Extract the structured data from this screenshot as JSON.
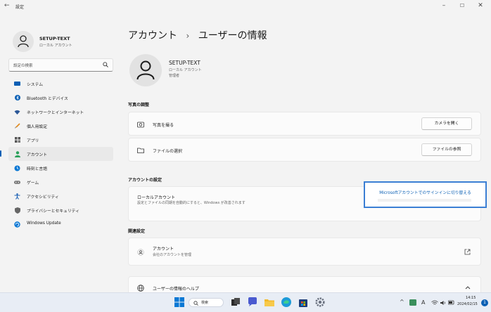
{
  "window": {
    "back_glyph": "←",
    "title": "設定",
    "minimize": "–",
    "maximize": "☐",
    "close": "✕"
  },
  "sidebar": {
    "profile_name": "SETUP-TEXT",
    "profile_sub": "ローカル アカウント",
    "search_placeholder": "設定の検索",
    "items": [
      {
        "label": "システム",
        "icon": "monitor-icon",
        "color": "#0a5fb4"
      },
      {
        "label": "Bluetooth とデバイス",
        "icon": "bluetooth-icon",
        "color": "#0a5fb4"
      },
      {
        "label": "ネットワークとインターネット",
        "icon": "wifi-icon",
        "color": "#2b5797"
      },
      {
        "label": "個人用設定",
        "icon": "brush-icon",
        "color": "#e08a1e"
      },
      {
        "label": "アプリ",
        "icon": "apps-icon",
        "color": "#555555"
      },
      {
        "label": "アカウント",
        "icon": "account-icon",
        "color": "#2aa05a"
      },
      {
        "label": "時刻と言語",
        "icon": "globe-clock-icon",
        "color": "#0a78d4"
      },
      {
        "label": "ゲーム",
        "icon": "gamepad-icon",
        "color": "#777777"
      },
      {
        "label": "アクセシビリティ",
        "icon": "accessibility-icon",
        "color": "#1a5fb4"
      },
      {
        "label": "プライバシーとセキュリティ",
        "icon": "shield-icon",
        "color": "#666666"
      },
      {
        "label": "Windows Update",
        "icon": "update-icon",
        "color": "#0a78d4"
      }
    ],
    "active_index": 5
  },
  "main": {
    "breadcrumb_parent": "アカウント",
    "breadcrumb_sep": "›",
    "breadcrumb_current": "ユーザーの情報",
    "user_name": "SETUP-TEXT",
    "user_type": "ローカル アカウント",
    "user_role": "管理者",
    "photo_section": "写真の調整",
    "take_photo_label": "写真を撮る",
    "take_photo_button": "カメラを開く",
    "choose_file_label": "ファイルの選択",
    "choose_file_button": "ファイルの参照",
    "account_section": "アカウントの設定",
    "local_account_label": "ローカルアカウント",
    "local_account_desc": "設定とファイルの同期を自動的にすると、Windows が改善されます",
    "ms_signin_link": "Microsoftアカウントでのサインインに切り替える",
    "related_section": "関連設定",
    "related_label": "アカウント",
    "related_desc": "会社のアカウントを管理",
    "help_label": "ユーザーの情報のヘルプ"
  },
  "taskbar": {
    "search_text": "検索",
    "tray_chevron": "^",
    "tray_lang": "A",
    "time": "14:15",
    "date": "2024/02/15",
    "notification_count": "1"
  }
}
